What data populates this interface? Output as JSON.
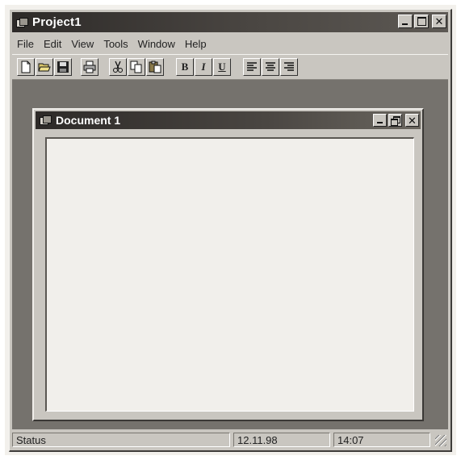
{
  "app": {
    "title": "Project1",
    "window_buttons": [
      "minimize-icon",
      "maximize-icon",
      "close-icon"
    ]
  },
  "menu": {
    "items": [
      {
        "label": "File"
      },
      {
        "label": "Edit"
      },
      {
        "label": "View"
      },
      {
        "label": "Tools"
      },
      {
        "label": "Window"
      },
      {
        "label": "Help"
      }
    ]
  },
  "toolbar": {
    "file_buttons": [
      "new-document-icon",
      "open-folder-icon",
      "save-disk-icon"
    ],
    "print_button": "printer-icon",
    "edit_buttons": [
      "cut-scissors-icon",
      "copy-icon",
      "paste-clipboard-icon"
    ],
    "format_buttons": [
      {
        "label": "B",
        "icon": "bold-icon"
      },
      {
        "label": "I",
        "icon": "italic-icon"
      },
      {
        "label": "U",
        "icon": "underline-icon"
      }
    ],
    "align_buttons": [
      "align-left-icon",
      "align-center-icon",
      "align-right-icon"
    ]
  },
  "document": {
    "title": "Document 1",
    "window_buttons": [
      "minimize-icon",
      "restore-icon",
      "close-icon"
    ]
  },
  "statusbar": {
    "status": "Status",
    "date": "12.11.98",
    "time": "14:07"
  },
  "colors": {
    "titlebar": "#2d2a28",
    "face": "#c9c6c0",
    "mdi_background": "#75726d",
    "document_background": "#f1efeb"
  }
}
